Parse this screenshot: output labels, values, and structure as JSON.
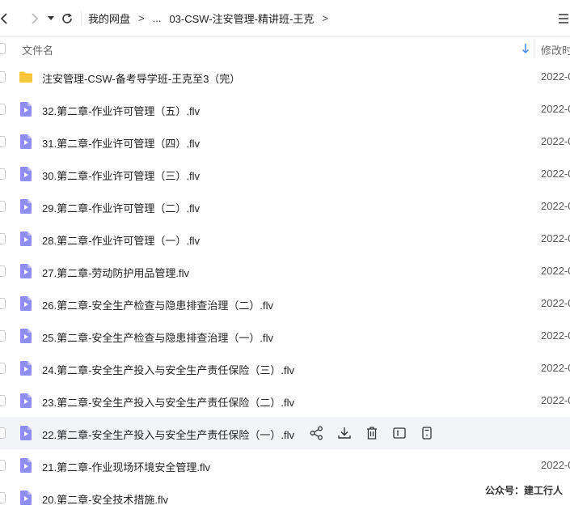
{
  "breadcrumb": {
    "root": "我的网盘",
    "ellipsis": "...",
    "current": "03-CSW-注安管理-精讲班-王克",
    "separator": ">"
  },
  "header": {
    "name_label": "文件名",
    "date_label": "修改时间"
  },
  "files": [
    {
      "name": "注安管理-CSW-备考导学班-王克至3（完）",
      "date": "2022-0",
      "type": "folder"
    },
    {
      "name": "32.第二章-作业许可管理（五）.flv",
      "date": "2022-0",
      "type": "video"
    },
    {
      "name": "31.第二章-作业许可管理（四）.flv",
      "date": "2022-0",
      "type": "video"
    },
    {
      "name": "30.第二章-作业许可管理（三）.flv",
      "date": "2022-0",
      "type": "video"
    },
    {
      "name": "29.第二章-作业许可管理（二）.flv",
      "date": "2022-0",
      "type": "video"
    },
    {
      "name": "28.第二章-作业许可管理（一）.flv",
      "date": "2022-0",
      "type": "video"
    },
    {
      "name": "27.第二章-劳动防护用品管理.flv",
      "date": "2022-0",
      "type": "video"
    },
    {
      "name": "26.第二章-安全生产检查与隐患排查治理（二）.flv",
      "date": "2022-0",
      "type": "video"
    },
    {
      "name": "25.第二章-安全生产检查与隐患排查治理（一）.flv",
      "date": "2022-0",
      "type": "video"
    },
    {
      "name": "24.第二章-安全生产投入与安全生产责任保险（三）.flv",
      "date": "2022-0",
      "type": "video"
    },
    {
      "name": "23.第二章-安全生产投入与安全生产责任保险（二）.flv",
      "date": "2022-0",
      "type": "video"
    },
    {
      "name": "22.第二章-安全生产投入与安全生产责任保险（一）.flv",
      "date": "",
      "type": "video",
      "hovered": true
    },
    {
      "name": "21.第二章-作业现场环境安全管理.flv",
      "date": "2022-0",
      "type": "video"
    },
    {
      "name": "20.第二章-安全技术措施.flv",
      "date": "",
      "type": "video"
    }
  ],
  "watermark": "公众号：建工行人",
  "icons": {
    "back": "chevron-left-icon",
    "forward": "chevron-right-icon",
    "history": "caret-down-icon",
    "refresh": "refresh-icon",
    "folder": "folder-icon",
    "video": "video-file-icon",
    "share": "share-icon",
    "download": "download-icon",
    "delete": "trash-icon",
    "rename": "rename-icon",
    "more": "more-icon"
  },
  "colors": {
    "folder": "#ffc73d",
    "video": "#8f8df7",
    "hover_row": "#f3f4f8"
  }
}
